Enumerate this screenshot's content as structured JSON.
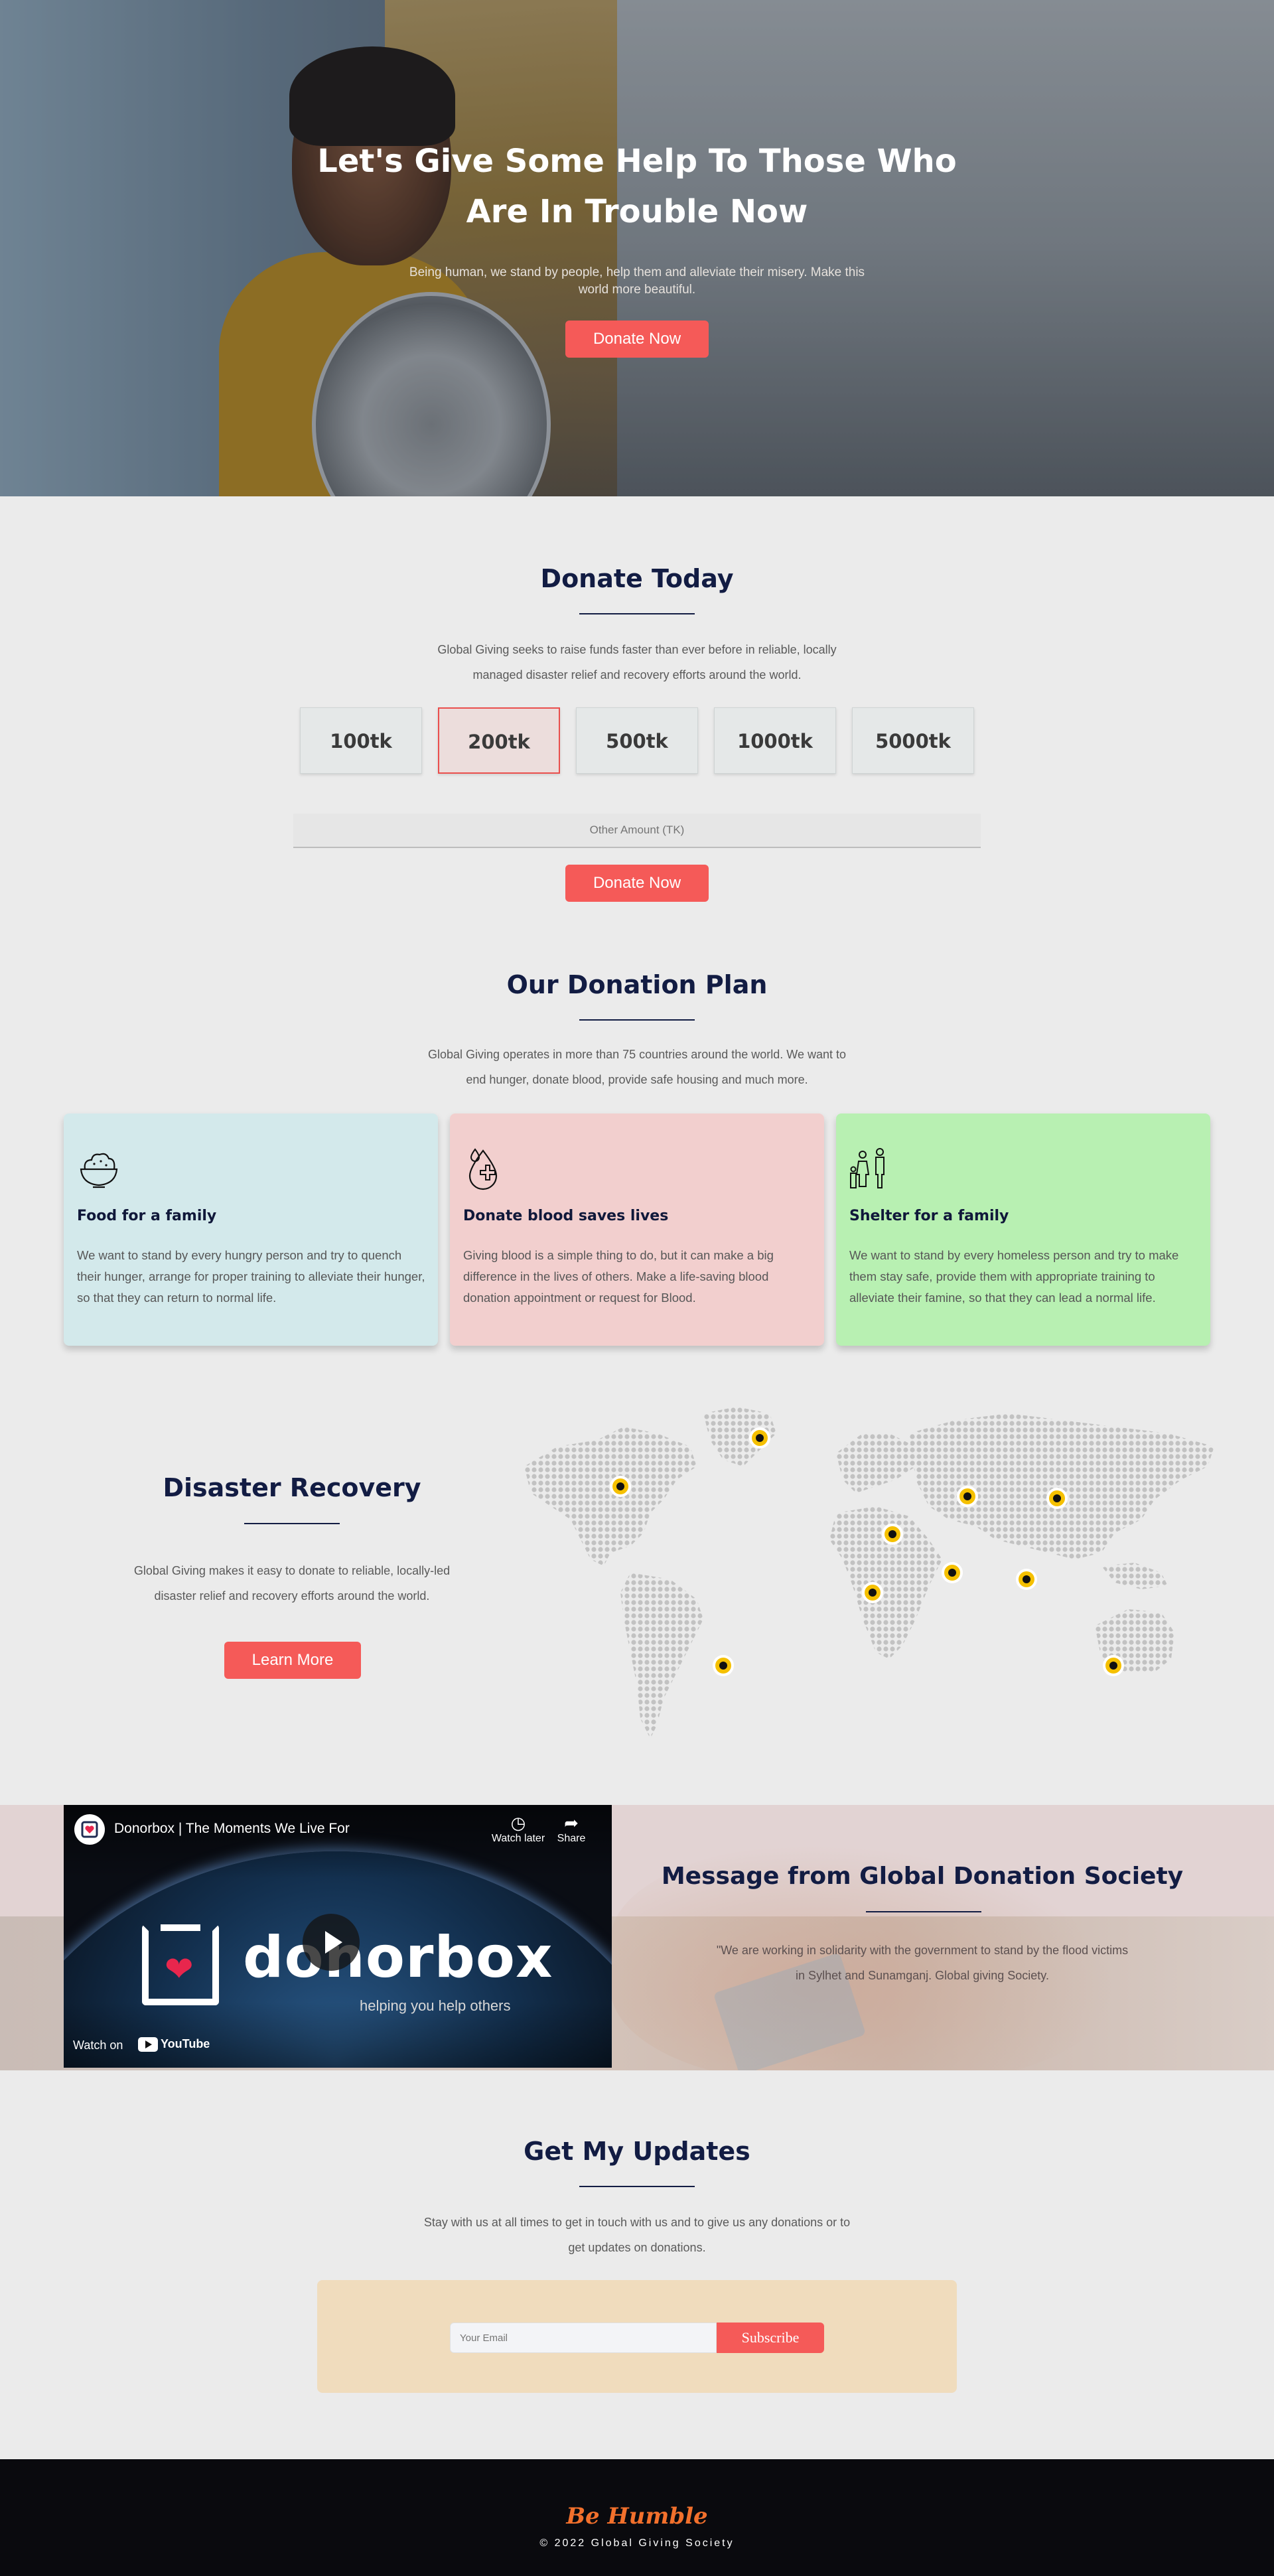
{
  "hero": {
    "title_line1": "Let's Give Some Help To Those Who",
    "title_line2": "Are In Trouble Now",
    "subtitle_line1": "Being human, we stand by people, help them and alleviate their misery. Make this",
    "subtitle_line2": "world more beautiful.",
    "button": "Donate Now"
  },
  "donate": {
    "title": "Donate Today",
    "text_line1": "Global Giving seeks to raise funds faster than ever before in reliable, locally",
    "text_line2": "managed disaster relief and recovery efforts around the world.",
    "amounts": [
      "100tk",
      "200tk",
      "500tk",
      "1000tk",
      "5000tk"
    ],
    "selected": "200tk",
    "other_placeholder": "Other Amount (TK)",
    "button": "Donate Now"
  },
  "plan": {
    "title": "Our Donation Plan",
    "text_line1": "Global Giving operates in more than 75 countries around the world. We want to",
    "text_line2": "end hunger, donate blood, provide safe housing and much more.",
    "cards": [
      {
        "icon": "food-bowl-icon",
        "title": "Food for a family",
        "text": "We want to stand by every hungry person and try to quench their hunger, arrange for proper training to alleviate their hunger, so that they can return to normal life.",
        "color": "#d3e9eb"
      },
      {
        "icon": "blood-drop-icon",
        "title": "Donate blood saves lives",
        "text": "Giving blood is a simple thing to do, but it can make a big difference in the lives of others. Make a life-saving blood donation appointment or request for Blood.",
        "color": "#f2cfce"
      },
      {
        "icon": "family-icon",
        "title": "Shelter for a family",
        "text": "We want to stand by every homeless person and try to make them stay safe, provide them with appropriate training to alleviate their famine, so that they can lead a normal life.",
        "color": "#b8f0b2"
      }
    ]
  },
  "disaster": {
    "title": "Disaster Recovery",
    "text_line1": "Global Giving makes it easy to donate to reliable, locally-led",
    "text_line2": "disaster relief and recovery efforts around the world.",
    "button": "Learn More",
    "marker_color": "#f5c000"
  },
  "video": {
    "channel_title": "Donorbox | The Moments We Live For",
    "watch_later": "Watch later",
    "share": "Share",
    "brand": "donorbox",
    "tagline": "helping you help others",
    "watch_on": "Watch on",
    "youtube": "YouTube"
  },
  "message": {
    "title": "Message from Global Donation Society",
    "text_line1": "\"We are working in solidarity with the government to stand by the flood victims",
    "text_line2": "in Sylhet and Sunamganj. Global giving Society."
  },
  "updates": {
    "title": "Get My Updates",
    "text_line1": "Stay with us at all times to get in touch with us and to give us any donations or to",
    "text_line2": "get updates on donations.",
    "email_placeholder": "Your Email",
    "button": "Subscribe"
  },
  "footer": {
    "logo": "Be Humble",
    "copyright": "© 2022 Global Giving Society"
  },
  "colors": {
    "accent": "#f55a58",
    "navy": "#121c43",
    "footer_logo": "#f2702c"
  }
}
